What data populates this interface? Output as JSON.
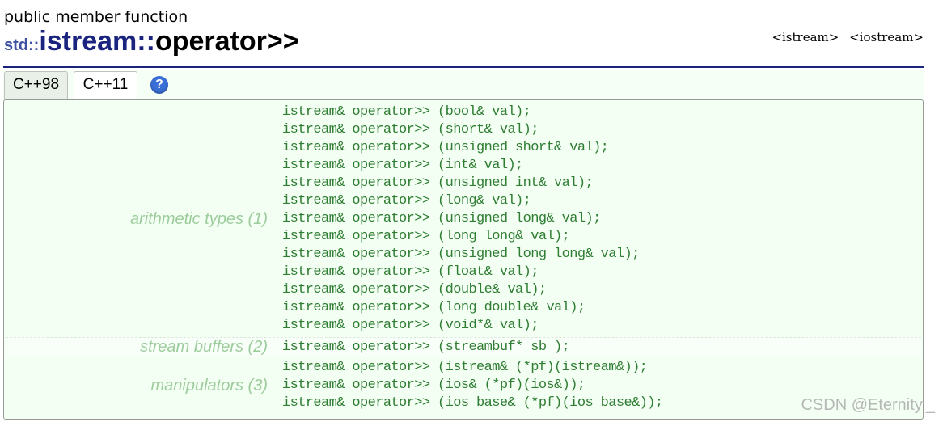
{
  "kind": "public member function",
  "title": {
    "namespace": "std::",
    "class": "istream",
    "separator": "::",
    "member": "operator>>"
  },
  "headers": [
    "<istream>",
    "<iostream>"
  ],
  "tabs": [
    {
      "label": "C++98"
    },
    {
      "label": "C++11"
    }
  ],
  "help_icon": {
    "icon": "question-icon",
    "glyph": "?"
  },
  "groups": [
    {
      "label": "arithmetic types (1)",
      "prototypes": [
        "istream& operator>> (bool& val);",
        "istream& operator>> (short& val);",
        "istream& operator>> (unsigned short& val);",
        "istream& operator>> (int& val);",
        "istream& operator>> (unsigned int& val);",
        "istream& operator>> (long& val);",
        "istream& operator>> (unsigned long& val);",
        "istream& operator>> (long long& val);",
        "istream& operator>> (unsigned long long& val);",
        "istream& operator>> (float& val);",
        "istream& operator>> (double& val);",
        "istream& operator>> (long double& val);",
        "istream& operator>> (void*& val);"
      ]
    },
    {
      "label": "stream buffers (2)",
      "prototypes": [
        "istream& operator>> (streambuf* sb );"
      ]
    },
    {
      "label": "manipulators (3)",
      "prototypes": [
        "istream& operator>> (istream& (*pf)(istream&));",
        "istream& operator>> (ios& (*pf)(ios&));",
        "istream& operator>> (ios_base& (*pf)(ios_base&));"
      ]
    }
  ],
  "watermark": "CSDN @Eternity._",
  "colors": {
    "title_rule": "#1a237e",
    "prototype_text": "#2e7d32",
    "group_label": "#9ccc9c",
    "panel_bg": "#f4fff4"
  }
}
